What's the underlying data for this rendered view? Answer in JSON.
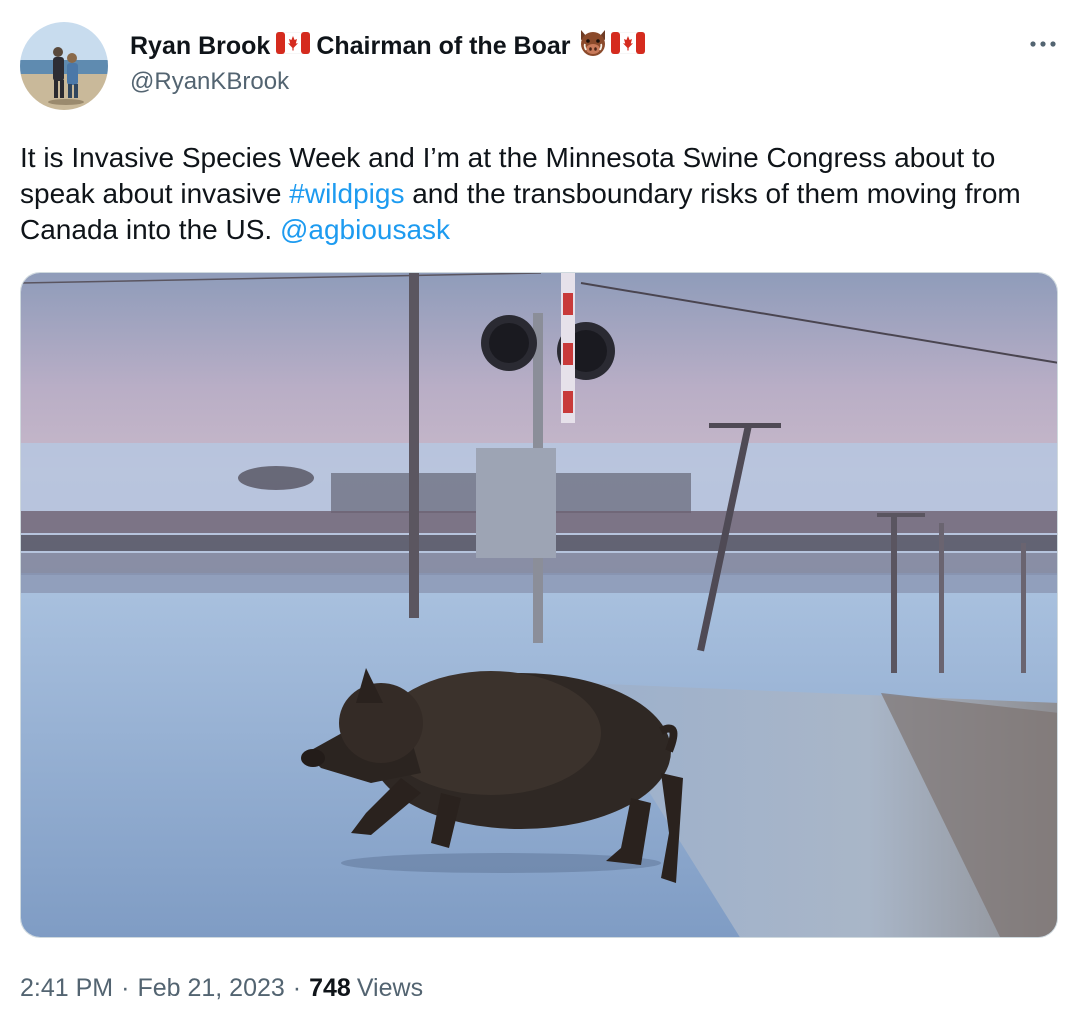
{
  "author": {
    "name": "Ryan Brook",
    "title": "Chairman of the Boar",
    "handle": "@RyanKBrook"
  },
  "icons": {
    "flag": "canada-flag-icon",
    "boar": "boar-face-icon",
    "more": "more-options-icon"
  },
  "colors": {
    "link": "#1d9bf0",
    "secondary_text": "#536471",
    "primary_text": "#0f1419"
  },
  "tweet": {
    "text_part1": "It is Invasive Species Week and I’m at the Minnesota Swine Congress about to speak about invasive ",
    "hashtag": "#wildpigs",
    "text_part2": " and the transboundary risks of them moving from Canada into the US. ",
    "mention": "@agbiousask"
  },
  "meta": {
    "time": "2:41 PM",
    "date": "Feb 21, 2023",
    "separator": "·",
    "views_count": "748",
    "views_label": "Views"
  }
}
